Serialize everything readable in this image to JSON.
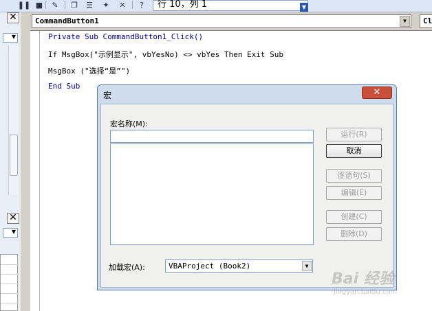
{
  "toolbar": {
    "position_text": "行 10，列 1",
    "icons": [
      "pause-icon",
      "stop-icon",
      "design-mode-icon",
      "project-explorer-icon",
      "properties-icon",
      "object-browser-icon",
      "toolbox-icon",
      "help-icon"
    ]
  },
  "code_window": {
    "object_combo": "CommandButton1",
    "procedure_combo": "Cl",
    "lines": [
      "Private Sub CommandButton1_Click()",
      "If MsgBox(\"示例显示\", vbYesNo) <> vbYes Then Exit Sub",
      "MsgBox (\"选择“是”\")",
      "End Sub"
    ]
  },
  "dialog": {
    "title": "宏",
    "name_label": "宏名称(M):",
    "name_value": "",
    "location_label": "加载宏(A):",
    "location_value": "VBAProject (Book2)",
    "buttons": {
      "run": "运行(R)",
      "cancel": "取消",
      "step_into": "逐语句(S)",
      "edit": "编辑(E)",
      "create": "创建(C)",
      "delete": "删除(D)"
    }
  },
  "watermark": {
    "text": "Bai 经验",
    "sub": "jingyan.baidu.com"
  },
  "colors": {
    "keyword": "#00008b",
    "dialog_frame": "#cfdcee",
    "close_button": "#c8503a"
  }
}
